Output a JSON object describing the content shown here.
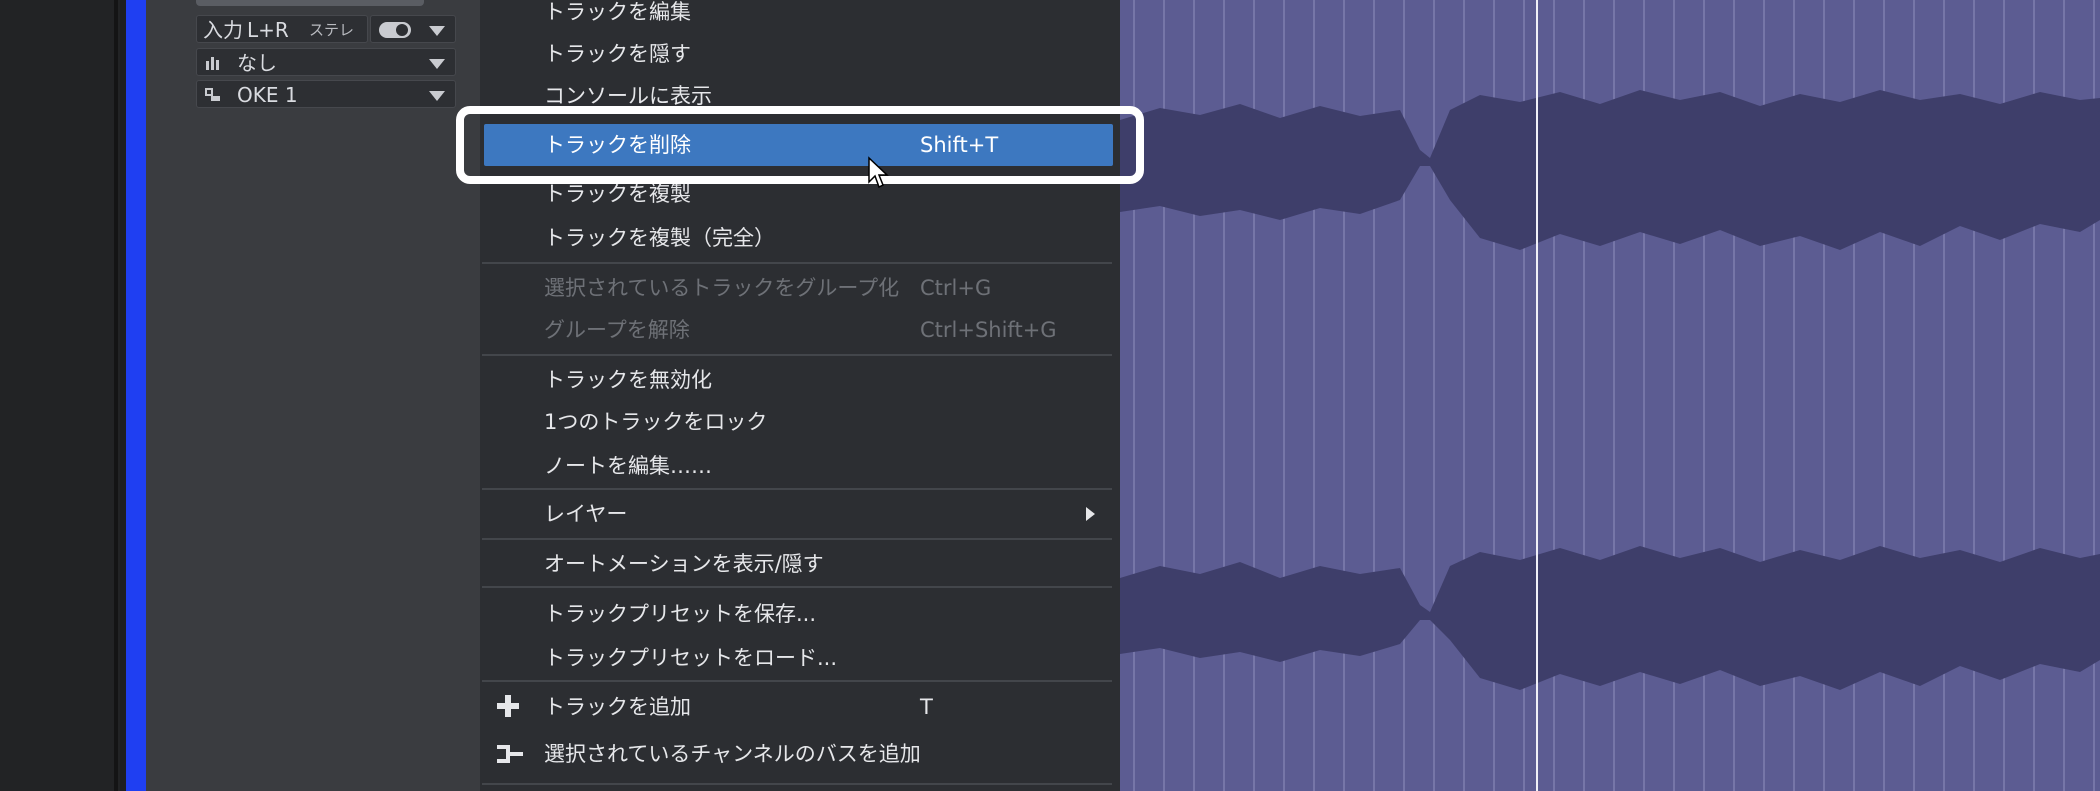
{
  "inspector": {
    "input_label": "入力",
    "input_value": "L+R",
    "stereo_label": "ステレオ",
    "send_value": "なし",
    "output_value": "OKE 1"
  },
  "context_menu": {
    "items": [
      {
        "label": "トラックを編集",
        "shortcut": "",
        "enabled": true
      },
      {
        "label": "トラックを隠す",
        "shortcut": "",
        "enabled": true
      },
      {
        "label": "コンソールに表示",
        "shortcut": "",
        "enabled": true
      },
      {
        "label": "トラックを削除",
        "shortcut": "Shift+T",
        "enabled": true,
        "highlighted": true
      },
      {
        "label": "トラックを複製",
        "shortcut": "",
        "enabled": true
      },
      {
        "label": "トラックを複製（完全）",
        "shortcut": "",
        "enabled": true
      },
      {
        "label": "選択されているトラックをグループ化",
        "shortcut": "Ctrl+G",
        "enabled": false
      },
      {
        "label": "グループを解除",
        "shortcut": "Ctrl+Shift+G",
        "enabled": false
      },
      {
        "label": "トラックを無効化",
        "shortcut": "",
        "enabled": true
      },
      {
        "label": "1つのトラックをロック",
        "shortcut": "",
        "enabled": true
      },
      {
        "label": "ノートを編集……",
        "shortcut": "",
        "enabled": true
      },
      {
        "label": "レイヤー",
        "shortcut": "",
        "enabled": true,
        "submenu": true
      },
      {
        "label": "オートメーションを表示/隠す",
        "shortcut": "",
        "enabled": true
      },
      {
        "label": "トラックプリセットを保存...",
        "shortcut": "",
        "enabled": true
      },
      {
        "label": "トラックプリセットをロード...",
        "shortcut": "",
        "enabled": true
      },
      {
        "label": "トラックを追加",
        "shortcut": "T",
        "enabled": true,
        "icon": "plus-icon"
      },
      {
        "label": "選択されているチャンネルのバスを追加",
        "shortcut": "",
        "enabled": true,
        "icon": "bus-icon"
      }
    ]
  },
  "colors": {
    "track_color": "#1f3ff2",
    "menu_bg": "#2c2e32",
    "highlight": "#3d78c0",
    "waveform_bg": "#5c5c92",
    "waveform_fill": "#3e3e6a"
  }
}
